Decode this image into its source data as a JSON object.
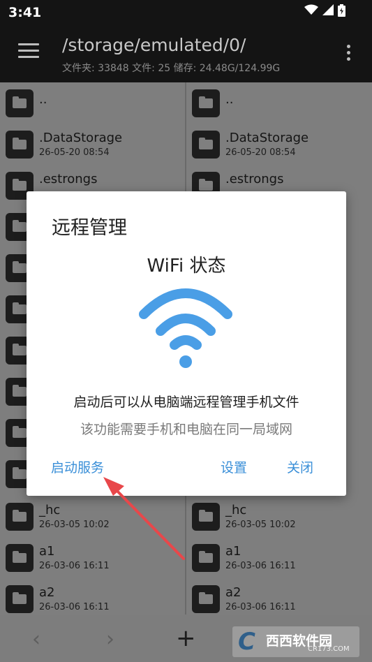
{
  "status_bar": {
    "time": "3:41",
    "icons": [
      "wifi-icon",
      "signal-icon",
      "battery-icon"
    ]
  },
  "app_bar": {
    "path": "/storage/emulated/0/",
    "stats": "文件夹: 33848  文件: 25  储存: 24.48G/124.99G",
    "menu_icon": "hamburger-menu-icon",
    "more_icon": "more-vert-icon"
  },
  "left_pane": {
    "rows": [
      {
        "name": "..",
        "date": ""
      },
      {
        "name": ".DataStorage",
        "date": "26-05-20 08:54"
      },
      {
        "name": ".estrongs",
        "date": ""
      }
    ],
    "bottom_rows": [
      {
        "name": "_hc",
        "date": "26-03-05 10:02"
      },
      {
        "name": "a1",
        "date": "26-03-06 16:11"
      },
      {
        "name": "a2",
        "date": "26-03-06 16:11"
      }
    ]
  },
  "right_pane": {
    "rows": [
      {
        "name": "..",
        "date": ""
      },
      {
        "name": ".DataStorage",
        "date": "26-05-20 08:54"
      },
      {
        "name": ".estrongs",
        "date": ""
      }
    ],
    "bottom_rows": [
      {
        "name": "_hc",
        "date": "26-03-05 10:02"
      },
      {
        "name": "a1",
        "date": "26-03-06 16:11"
      },
      {
        "name": "a2",
        "date": "26-03-06 16:11"
      }
    ]
  },
  "bottom_bar": {
    "back": "‹",
    "forward": "›",
    "add": "+"
  },
  "watermark": {
    "logo": "C",
    "text": "西西软件园",
    "url": "CR173.COM"
  },
  "dialog": {
    "title": "远程管理",
    "subtitle": "WiFi 状态",
    "line1": "启动后可以从电脑端远程管理手机文件",
    "line2": "该功能需要手机和电脑在同一局域网",
    "start_label": "启动服务",
    "settings_label": "设置",
    "close_label": "关闭",
    "accent_color": "#3a8fd8",
    "wifi_color": "#4a9ee6"
  }
}
